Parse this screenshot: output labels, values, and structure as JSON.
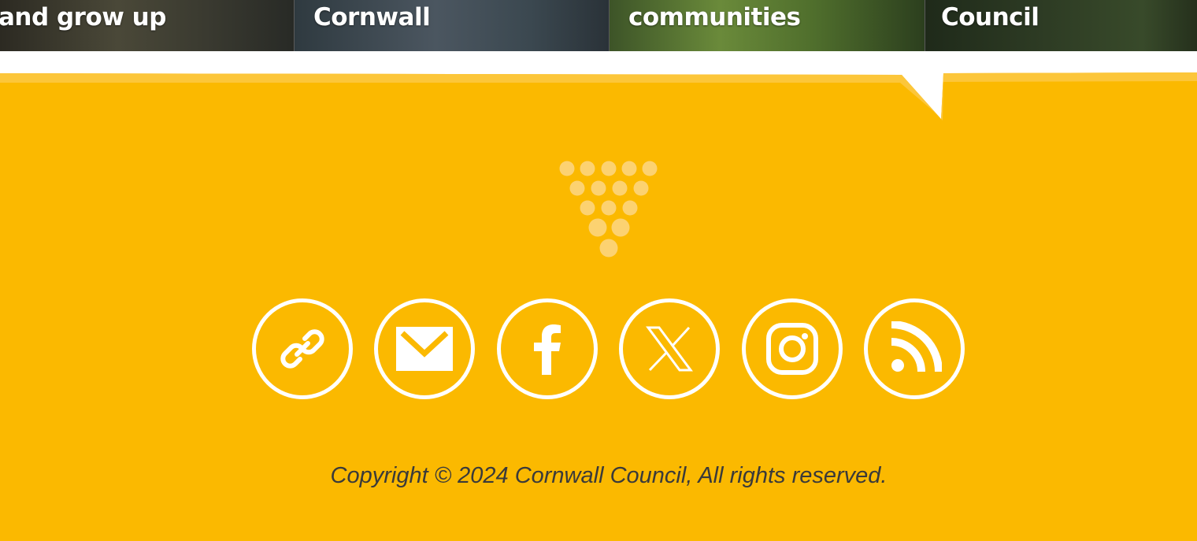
{
  "tiles": [
    {
      "label": "and grow up"
    },
    {
      "label": "Cornwall"
    },
    {
      "label": "communities"
    },
    {
      "label": "Council"
    }
  ],
  "footer": {
    "background_color": "#FBB900",
    "social_links": [
      {
        "icon": "link-icon"
      },
      {
        "icon": "email-icon"
      },
      {
        "icon": "facebook-icon"
      },
      {
        "icon": "x-icon"
      },
      {
        "icon": "instagram-icon"
      },
      {
        "icon": "rss-icon"
      }
    ],
    "copyright": "Copyright © 2024 Cornwall Council, All rights reserved."
  }
}
